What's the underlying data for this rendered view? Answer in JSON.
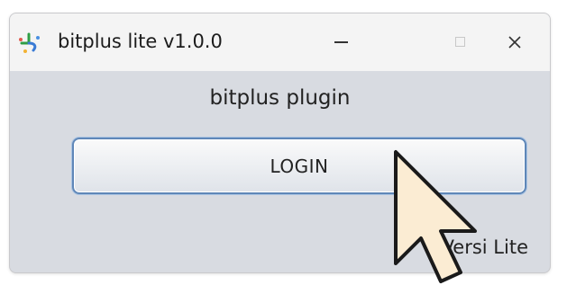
{
  "window": {
    "title": "bitplus lite v1.0.0",
    "controls": {
      "minimize": "minimize-icon",
      "maximize": "maximize-icon",
      "close": "close-icon"
    }
  },
  "main": {
    "plugin_label": "bitplus plugin",
    "login_label": "LOGIN",
    "version_label": "Versi Lite"
  },
  "colors": {
    "window_bg": "#d8dbe1",
    "titlebar_bg": "#f4f4f4",
    "button_border": "#5f87b8",
    "cursor_fill": "#fbecd3"
  }
}
